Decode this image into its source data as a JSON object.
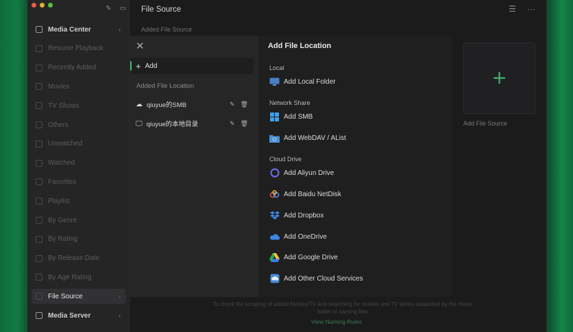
{
  "sidebar": {
    "items": [
      {
        "label": "Media Center",
        "style": "bright",
        "chev": "›"
      },
      {
        "label": "Resume Playback"
      },
      {
        "label": "Recently Added"
      },
      {
        "label": "Movies"
      },
      {
        "label": "TV Shows"
      },
      {
        "label": "Others"
      },
      {
        "label": "Unwatched"
      },
      {
        "label": "Watched"
      },
      {
        "label": "Favorites"
      },
      {
        "label": "Playlist"
      },
      {
        "label": "By Genre"
      },
      {
        "label": "By Rating"
      },
      {
        "label": "By Release Date"
      },
      {
        "label": "By Age Rating"
      },
      {
        "label": "File Source",
        "style": "active",
        "chev": "›"
      },
      {
        "label": "Media Server",
        "style": "bright",
        "chev": "›"
      }
    ]
  },
  "header": {
    "title": "File Source",
    "subtitle": "Added File Source"
  },
  "tile": {
    "label": "Add File Source",
    "plus": "+"
  },
  "footer": {
    "text": "To check the scraping of added Movies/TV and searching for movies and TV series supported by the movie folder or naming files",
    "link": "View Naming Rules"
  },
  "modal": {
    "add_label": "Add",
    "added_location_label": "Added File Location",
    "locations": [
      {
        "name": "qiuyue的SMB",
        "icon": "cloud-icon"
      },
      {
        "name": "qiuyue的本地目录",
        "icon": "monitor-icon"
      }
    ],
    "title": "Add File Location",
    "sections": {
      "local": "Local",
      "network": "Network Share",
      "cloud": "Cloud Drive"
    },
    "options": {
      "local_folder": "Add Local Folder",
      "smb": "Add SMB",
      "webdav": "Add WebDAV / AList",
      "aliyun": "Add Aliyun Drive",
      "baidu": "Add Baidu NetDisk",
      "dropbox": "Add Dropbox",
      "onedrive": "Add OneDrive",
      "gdrive": "Add Google Drive",
      "other": "Add Other Cloud Services"
    }
  },
  "colors": {
    "accent": "#3fbf6a",
    "modal_bg": "#1f1f20",
    "sidebar_bg": "#252526"
  }
}
